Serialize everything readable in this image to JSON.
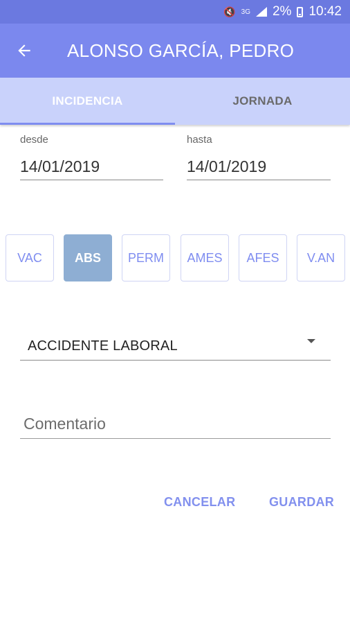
{
  "status_bar": {
    "network": "3G",
    "battery": "2%",
    "time": "10:42",
    "icons": [
      "mute-icon",
      "signal-icon",
      "battery-icon"
    ]
  },
  "header": {
    "title": "ALONSO GARCÍA, PEDRO",
    "back_icon": "arrow-left-icon"
  },
  "tabs": [
    {
      "label": "INCIDENCIA",
      "active": true
    },
    {
      "label": "JORNADA",
      "active": false
    }
  ],
  "dates": {
    "from": {
      "label": "desde",
      "value": "14/01/2019"
    },
    "to": {
      "label": "hasta",
      "value": "14/01/2019"
    }
  },
  "categories": [
    {
      "label": "VAC",
      "selected": false
    },
    {
      "label": "ABS",
      "selected": true
    },
    {
      "label": "PERM",
      "selected": false
    },
    {
      "label": "AMES",
      "selected": false
    },
    {
      "label": "AFES",
      "selected": false
    },
    {
      "label": "V.AN",
      "selected": false
    }
  ],
  "reason_select": {
    "value": "ACCIDENTE LABORAL"
  },
  "comment": {
    "placeholder": "Comentario"
  },
  "actions": {
    "cancel": "CANCELAR",
    "save": "GUARDAR"
  },
  "colors": {
    "status_bar": "#6b79e0",
    "app_bar": "#7b88ee",
    "tabs_bg": "#c9d2fb",
    "accent": "#7f8df0",
    "selected_category": "#8eaed3"
  }
}
